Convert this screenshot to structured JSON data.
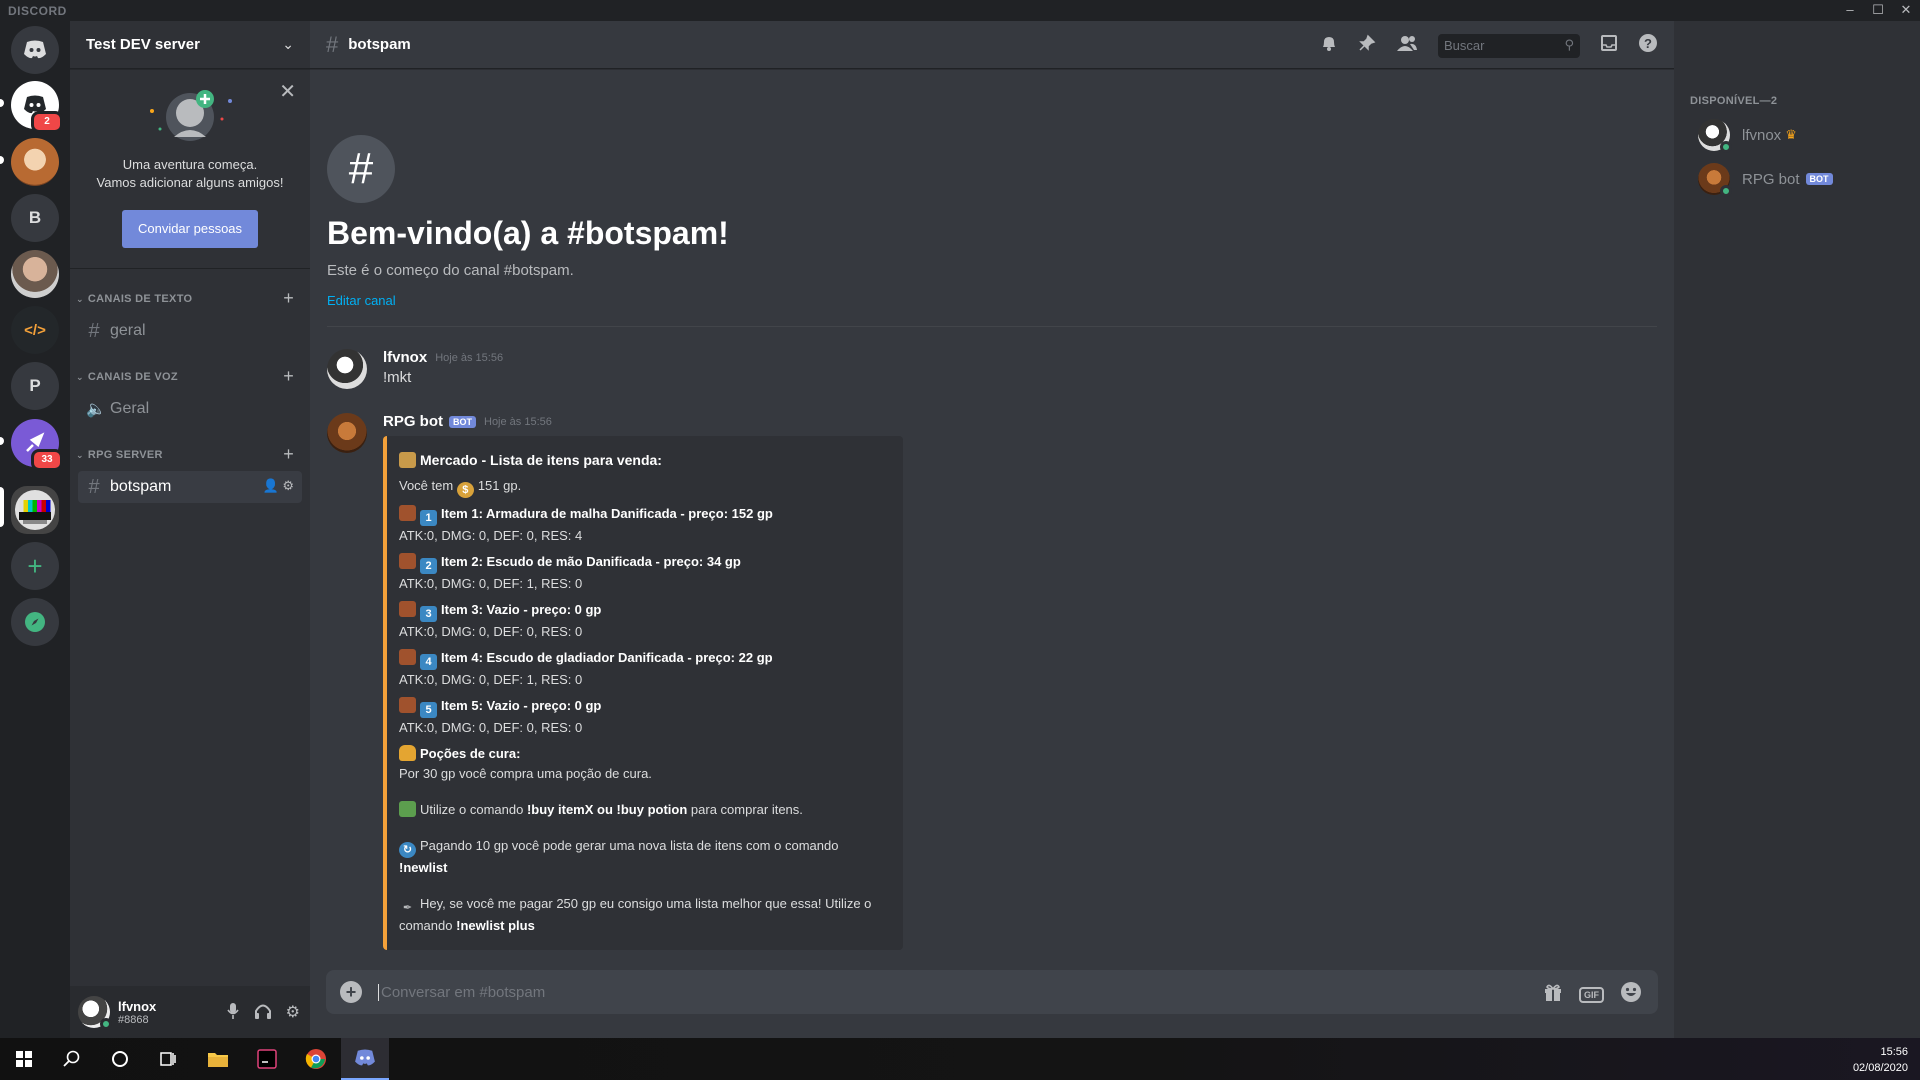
{
  "window": {
    "title": "DISCORD",
    "controls": [
      "minimize-icon",
      "maximize-icon",
      "close-icon"
    ]
  },
  "servers": [
    {
      "name": "home",
      "icon": "discord-icon",
      "badge": "2"
    },
    {
      "name": "dog-server",
      "icon": "dog-avatar-icon"
    },
    {
      "name": "B",
      "label": "B"
    },
    {
      "name": "person-server",
      "icon": "person-avatar-icon"
    },
    {
      "name": "code-server",
      "icon": "code-icon",
      "label": "</>"
    },
    {
      "name": "P",
      "label": "P"
    },
    {
      "name": "rocket-server",
      "icon": "rocket-icon",
      "badge": "33"
    },
    {
      "name": "test-dev-server",
      "icon": "test-pattern-icon",
      "active": true
    },
    {
      "name": "add-server",
      "icon": "plus-icon",
      "label": "+"
    },
    {
      "name": "explore",
      "icon": "compass-icon"
    }
  ],
  "sidebar": {
    "server_name": "Test DEV server",
    "invite": {
      "line1": "Uma aventura começa.",
      "line2": "Vamos adicionar alguns amigos!",
      "button": "Convidar pessoas"
    },
    "categories": [
      {
        "label": "CANAIS DE TEXTO",
        "channels": [
          {
            "name": "geral",
            "type": "text"
          }
        ]
      },
      {
        "label": "CANAIS DE VOZ",
        "channels": [
          {
            "name": "Geral",
            "type": "voice"
          }
        ]
      },
      {
        "label": "RPG SERVER",
        "channels": [
          {
            "name": "botspam",
            "type": "text",
            "selected": true
          }
        ]
      }
    ],
    "user": {
      "name": "lfvnox",
      "tag": "#8868"
    }
  },
  "header": {
    "channel": "botspam",
    "search_placeholder": "Buscar"
  },
  "welcome": {
    "title": "Bem-vindo(a) a #botspam!",
    "subtitle": "Este é o começo do canal #botspam.",
    "edit": "Editar canal"
  },
  "messages": [
    {
      "author": "lfvnox",
      "time": "Hoje às 15:56",
      "text": "!mkt"
    },
    {
      "author": "RPG bot",
      "bot_tag": "BOT",
      "time": "Hoje às 15:56",
      "embed": {
        "accent": "#f4a13a",
        "title": "Mercado - Lista de itens para venda:",
        "gold_prefix": "Você tem",
        "gold_value": "151 gp.",
        "items": [
          {
            "num": "1",
            "title": "Item 1: Armadura de malha Danificada - preço: 152 gp",
            "stats": "ATK:0, DMG: 0, DEF: 0, RES: 4"
          },
          {
            "num": "2",
            "title": "Item 2: Escudo de mão Danificada - preço: 34 gp",
            "stats": "ATK:0, DMG: 0, DEF: 1, RES: 0"
          },
          {
            "num": "3",
            "title": "Item 3: Vazio - preço: 0 gp",
            "stats": "ATK:0, DMG: 0, DEF: 0, RES: 0"
          },
          {
            "num": "4",
            "title": "Item 4: Escudo de gladiador Danificada - preço: 22 gp",
            "stats": "ATK:0, DMG: 0, DEF: 1, RES: 0"
          },
          {
            "num": "5",
            "title": "Item 5: Vazio - preço: 0 gp",
            "stats": "ATK:0, DMG: 0, DEF: 0, RES: 0"
          }
        ],
        "potions_title": "Poções de cura:",
        "potions_text": "Por 30 gp você compra uma poção de cura.",
        "buy_pre": "Utilize o comando",
        "buy_cmd": "!buy itemX ou !buy potion",
        "buy_post": "para comprar itens.",
        "newlist_pre": "Pagando 10 gp você pode gerar uma nova lista de itens com o comando",
        "newlist_cmd": "!newlist",
        "plus_pre": "Hey, se você me pagar 250 gp eu consigo uma lista melhor que essa! Utilize o comando",
        "plus_cmd": "!newlist plus"
      }
    }
  ],
  "composer": {
    "placeholder": "Conversar em #botspam"
  },
  "members": {
    "heading": "DISPONÍVEL—2",
    "list": [
      {
        "name": "lfvnox",
        "owner": true
      },
      {
        "name": "RPG bot",
        "bot_tag": "BOT"
      }
    ]
  },
  "taskbar": {
    "time": "15:56",
    "date": "02/08/2020",
    "apps": [
      "windows-start-icon",
      "search-icon",
      "cortana-icon",
      "task-view-icon",
      "file-explorer-icon",
      "terminal-icon",
      "chrome-icon",
      "discord-icon"
    ]
  },
  "colors": {
    "accent": "#7289da",
    "online": "#43b581",
    "embed_border": "#f4a13a",
    "mention_badge": "#f04747"
  }
}
